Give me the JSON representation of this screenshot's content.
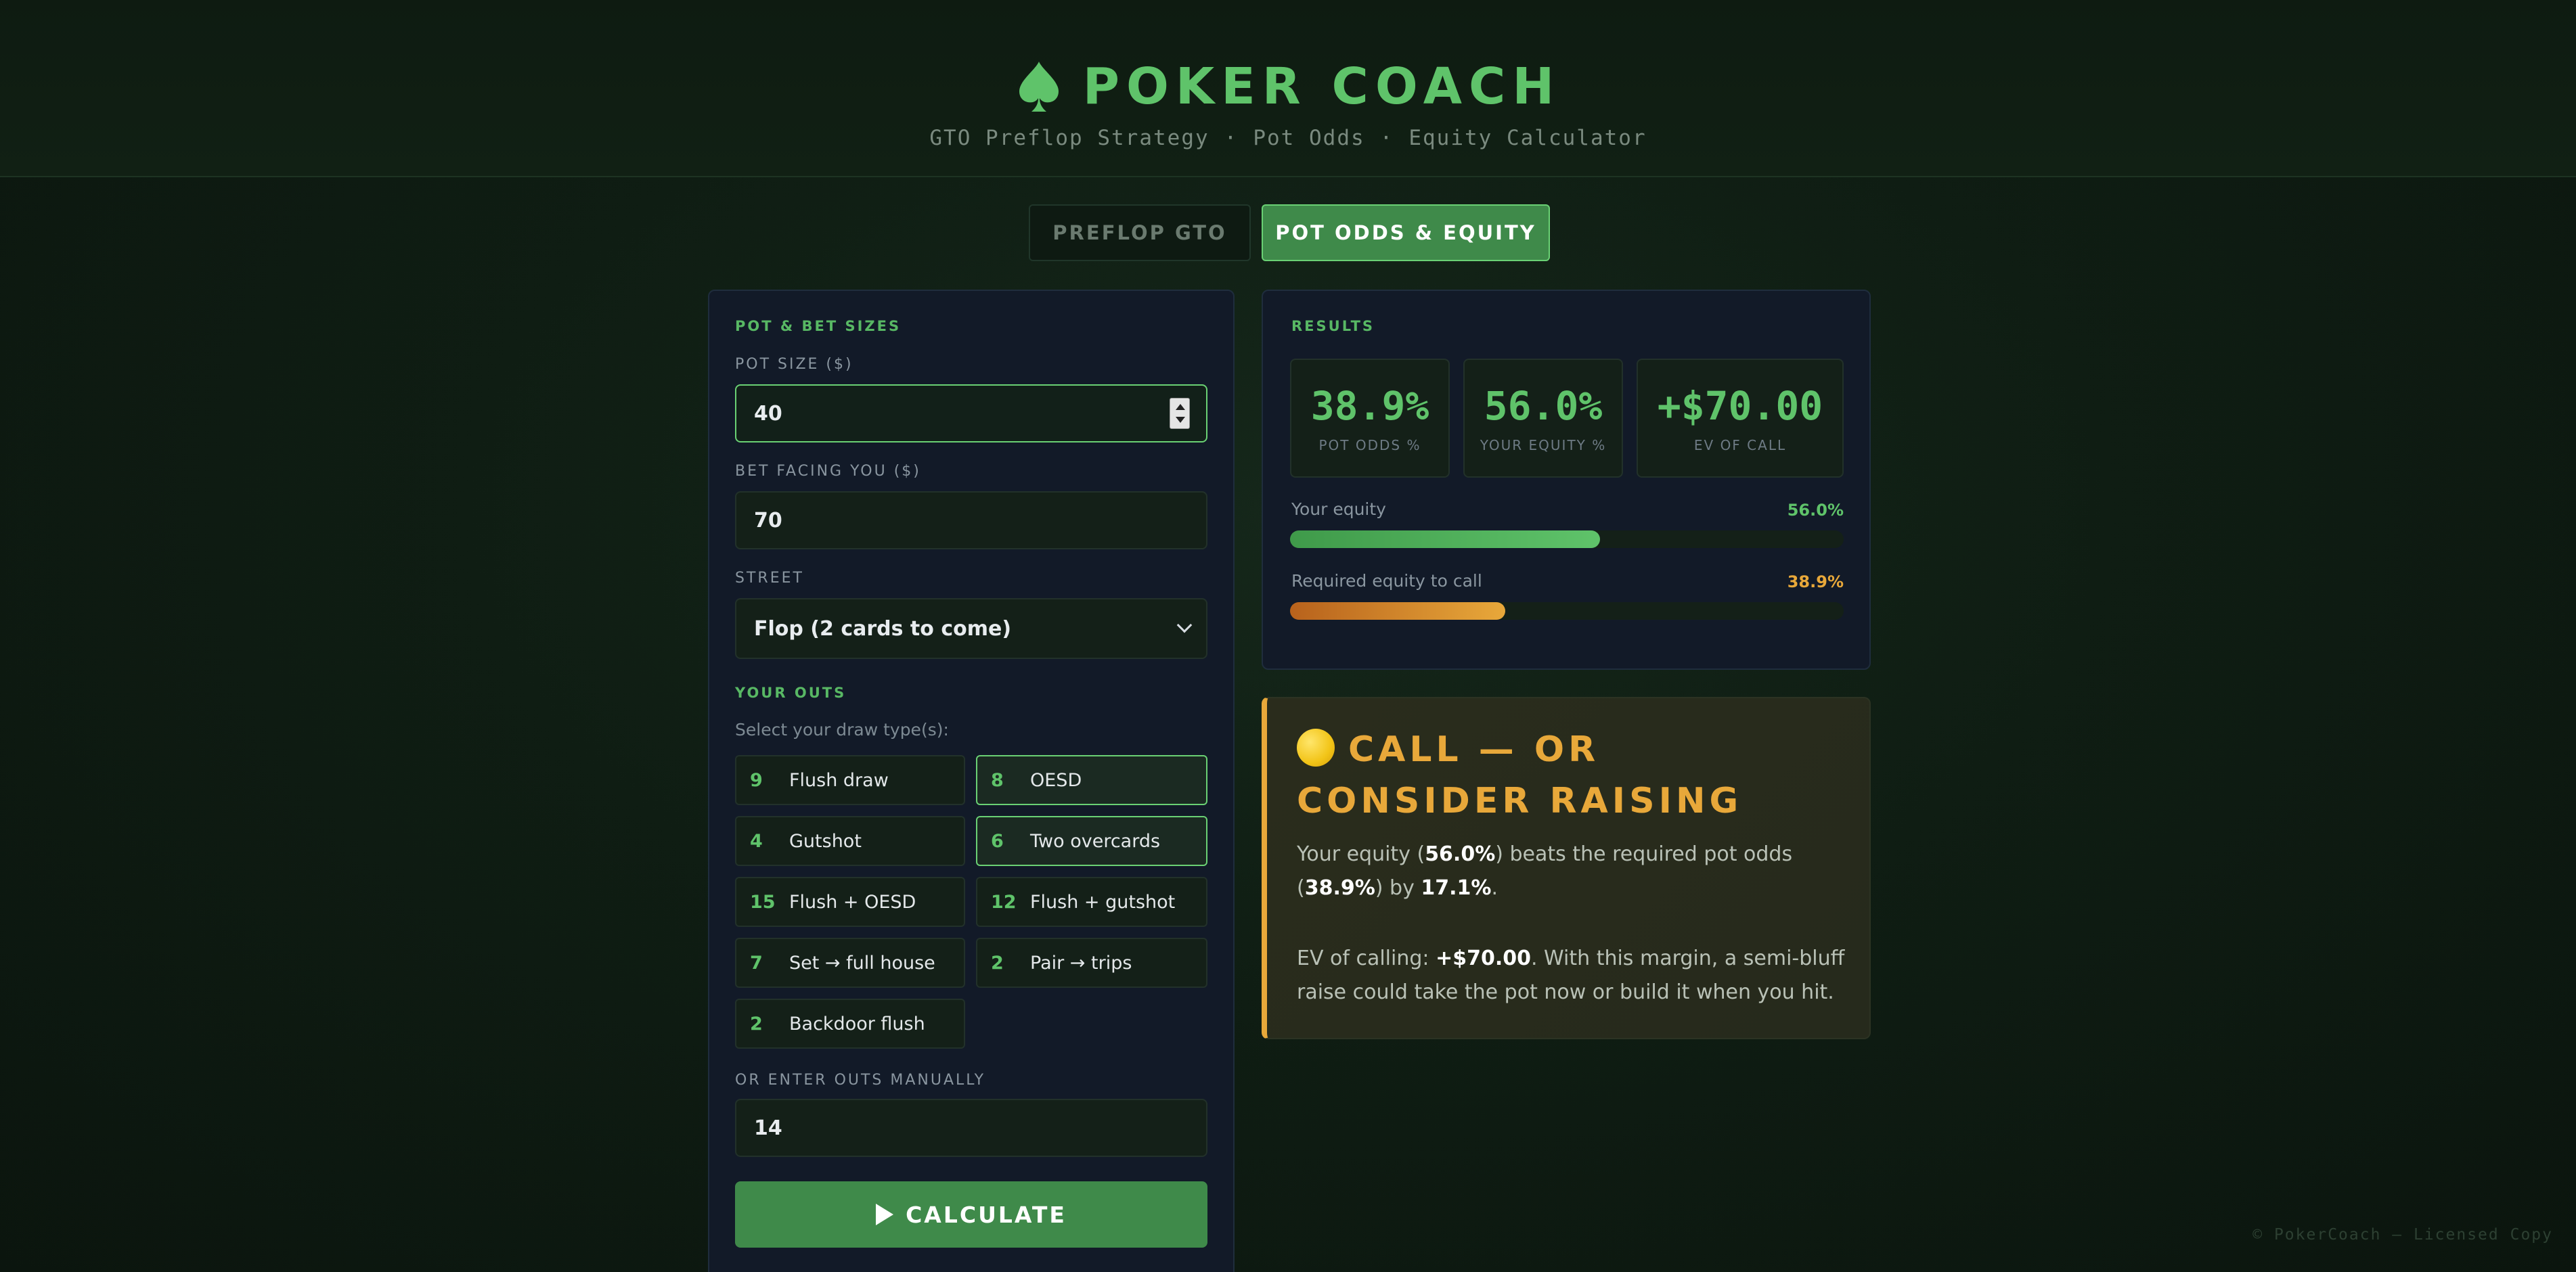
{
  "header": {
    "title": "POKER COACH",
    "subtitle_items": [
      "GTO Preflop Strategy",
      "Pot Odds",
      "Equity Calculator"
    ],
    "separator": "·"
  },
  "tabs": [
    {
      "label": "PREFLOP GTO",
      "active": false
    },
    {
      "label": "POT ODDS & EQUITY",
      "active": true
    }
  ],
  "form": {
    "section_title": "POT & BET SIZES",
    "pot_size": {
      "label": "POT SIZE ($)",
      "value": "40"
    },
    "bet_facing": {
      "label": "BET FACING YOU ($)",
      "value": "70"
    },
    "street": {
      "label": "STREET",
      "value": "Flop (2 cards to come)"
    },
    "outs": {
      "section_title": "YOUR OUTS",
      "hint": "Select your draw type(s):",
      "options": [
        {
          "count": "9",
          "label": "Flush draw",
          "selected": false
        },
        {
          "count": "8",
          "label": "OESD",
          "selected": true
        },
        {
          "count": "4",
          "label": "Gutshot",
          "selected": false
        },
        {
          "count": "6",
          "label": "Two overcards",
          "selected": true
        },
        {
          "count": "15",
          "label": "Flush + OESD",
          "selected": false
        },
        {
          "count": "12",
          "label": "Flush + gutshot",
          "selected": false
        },
        {
          "count": "7",
          "label": "Set → full house",
          "selected": false
        },
        {
          "count": "2",
          "label": "Pair → trips",
          "selected": false
        },
        {
          "count": "2",
          "label": "Backdoor flush",
          "selected": false
        }
      ]
    },
    "manual_outs": {
      "label": "OR ENTER OUTS MANUALLY",
      "value": "14"
    },
    "calculate_label": "CALCULATE"
  },
  "results": {
    "section_title": "RESULTS",
    "stats": [
      {
        "value": "38.9%",
        "label": "POT ODDS %"
      },
      {
        "value": "56.0%",
        "label": "YOUR EQUITY %"
      },
      {
        "value": "+$70.00",
        "label": "EV OF CALL"
      }
    ],
    "bars": [
      {
        "label": "Your equity",
        "value_text": "56.0%",
        "fraction": 0.56,
        "color": "#5fc36a"
      },
      {
        "label": "Required equity to call",
        "value_text": "38.9%",
        "fraction": 0.389,
        "color": "#e8a83a"
      }
    ]
  },
  "verdict": {
    "icon": "yellow-circle-icon",
    "title": "CALL — OR CONSIDER RAISING",
    "p1": {
      "a": "Your equity (",
      "equity": "56.0%",
      "b": ") beats the required pot odds (",
      "odds": "38.9%",
      "c": ") by ",
      "margin": "17.1%",
      "d": "."
    },
    "p2": {
      "a": "EV of calling: ",
      "ev": "+$70.00",
      "b": ". With this margin, a semi-bluff raise could take the pot now or build it when you hit."
    }
  },
  "footer": "© PokerCoach — Licensed Copy",
  "colors": {
    "accent": "#5fc36a",
    "warning": "#e8a83a",
    "panel": "#121a28"
  }
}
